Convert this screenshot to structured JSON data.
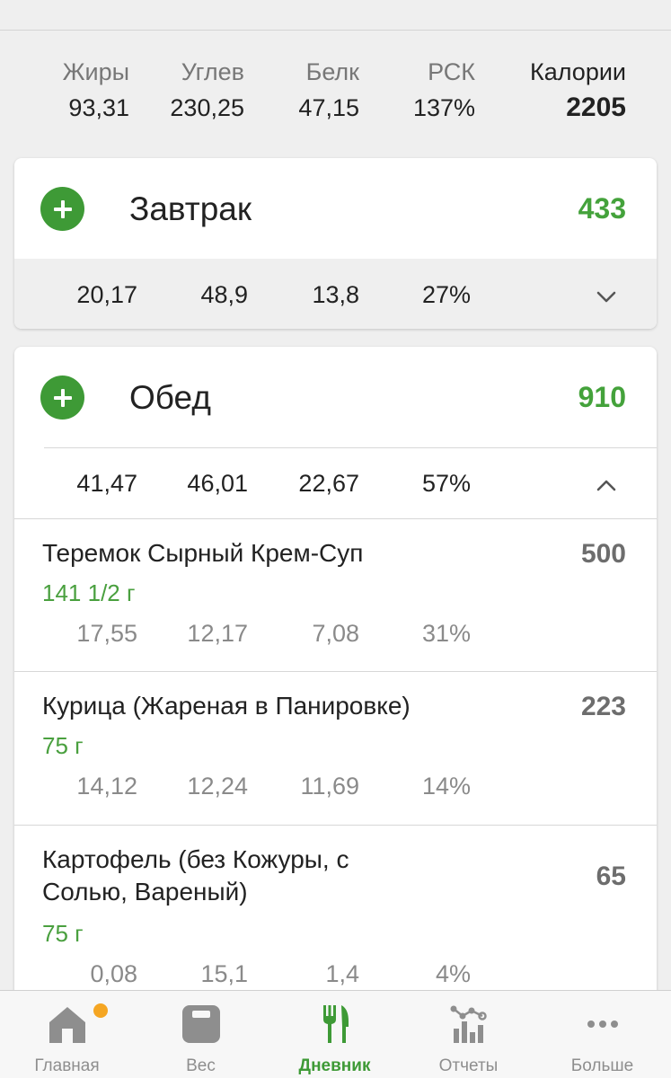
{
  "summary": {
    "fat_label": "Жиры",
    "fat": "93,31",
    "carb_label": "Углев",
    "carb": "230,25",
    "protein_label": "Белк",
    "protein": "47,15",
    "rsk_label": "РСК",
    "rsk": "137%",
    "cal_label": "Калории",
    "cal": "2205"
  },
  "breakfast": {
    "title": "Завтрак",
    "calories": "433",
    "fat": "20,17",
    "carb": "48,9",
    "protein": "13,8",
    "rsk": "27%"
  },
  "lunch": {
    "title": "Обед",
    "calories": "910",
    "fat": "41,47",
    "carb": "46,01",
    "protein": "22,67",
    "rsk": "57%",
    "items": [
      {
        "name": "Теремок Сырный Крем-Суп",
        "portion": "141 1/2 г",
        "calories": "500",
        "fat": "17,55",
        "carb": "12,17",
        "protein": "7,08",
        "rsk": "31%"
      },
      {
        "name": "Курица (Жареная в Панировке)",
        "portion": "75 г",
        "calories": "223",
        "fat": "14,12",
        "carb": "12,24",
        "protein": "11,69",
        "rsk": "14%"
      },
      {
        "name_line1": "Картофель (без Кожуры, с",
        "name_line2": "Солью, Вареный)",
        "portion": "75 г",
        "calories": "65",
        "fat": "0,08",
        "carb": "15,1",
        "protein": "1,4",
        "rsk": "4%"
      }
    ]
  },
  "tabs": {
    "home": "Главная",
    "weight": "Вес",
    "diary": "Дневник",
    "reports": "Отчеты",
    "more": "Больше"
  },
  "colors": {
    "accent": "#3e9a36",
    "calorie_green": "#44a23b",
    "badge": "#f5a623"
  }
}
